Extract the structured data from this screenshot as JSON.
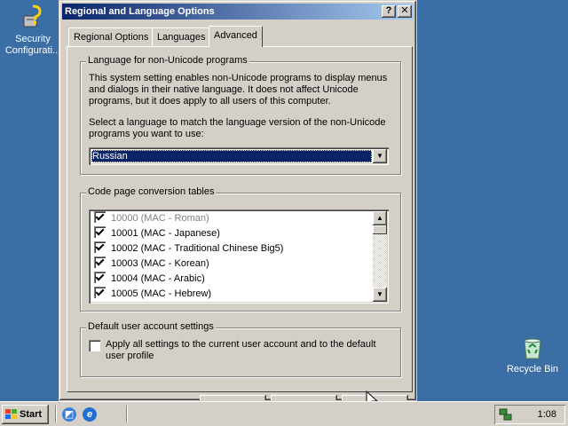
{
  "desktop": {
    "security_icon_label": "Security Configurati...",
    "recycle_bin_label": "Recycle Bin"
  },
  "dialog": {
    "title": "Regional and Language Options",
    "help_button": "?",
    "close_button": "✕",
    "tabs": [
      {
        "label": "Regional Options",
        "active": false
      },
      {
        "label": "Languages",
        "active": false
      },
      {
        "label": "Advanced",
        "active": true
      }
    ],
    "non_unicode": {
      "group_title": "Language for non-Unicode programs",
      "description": "This system setting enables non-Unicode programs to display menus and dialogs in their native language. It does not affect Unicode programs, but it does apply to all users of this computer.",
      "select_prompt": "Select a language to match the language version of the non-Unicode programs you want to use:",
      "selected_language": "Russian"
    },
    "code_pages": {
      "group_title": "Code page conversion tables",
      "items": [
        {
          "label": "10000 (MAC - Roman)",
          "checked": true,
          "dimmed": true
        },
        {
          "label": "10001 (MAC - Japanese)",
          "checked": true,
          "dimmed": false
        },
        {
          "label": "10002 (MAC - Traditional Chinese Big5)",
          "checked": true,
          "dimmed": false
        },
        {
          "label": "10003 (MAC - Korean)",
          "checked": true,
          "dimmed": false
        },
        {
          "label": "10004 (MAC - Arabic)",
          "checked": true,
          "dimmed": false
        },
        {
          "label": "10005 (MAC - Hebrew)",
          "checked": true,
          "dimmed": false
        }
      ]
    },
    "default_user": {
      "group_title": "Default user account settings",
      "checkbox_label": "Apply all settings to the current user account and to the default user profile",
      "checked": false
    }
  },
  "taskbar": {
    "start_label": "Start",
    "clock": "1:08"
  },
  "colors": {
    "desktop": "#3a6ea5",
    "title_active": "#0a246a",
    "face": "#d4d0c8"
  }
}
